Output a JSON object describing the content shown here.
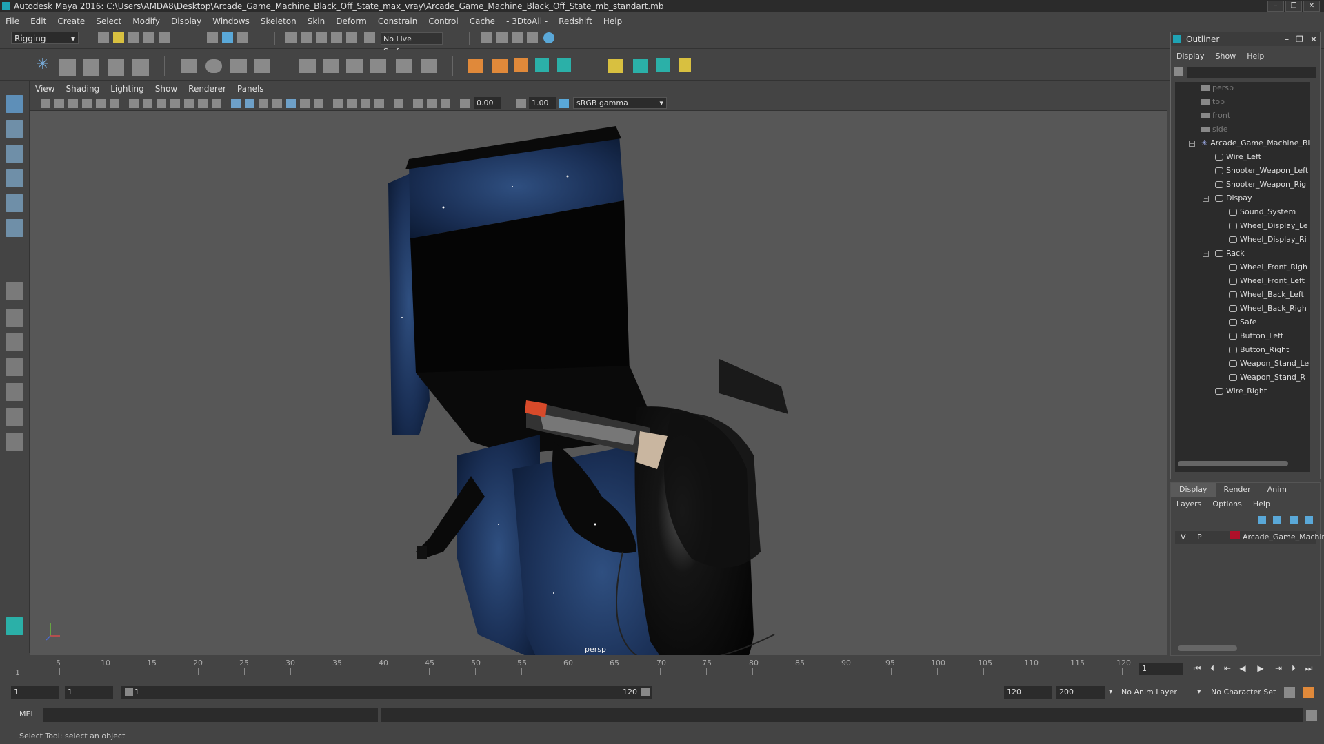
{
  "window": {
    "title": "Autodesk Maya 2016: C:\\Users\\AMDA8\\Desktop\\Arcade_Game_Machine_Black_Off_State_max_vray\\Arcade_Game_Machine_Black_Off_State_mb_standart.mb",
    "buttons": [
      "–",
      "❐",
      "✕"
    ]
  },
  "menu": [
    "File",
    "Edit",
    "Create",
    "Select",
    "Modify",
    "Display",
    "Windows",
    "Skeleton",
    "Skin",
    "Deform",
    "Constrain",
    "Control",
    "Cache",
    "- 3DtoAll -",
    "Redshift",
    "Help"
  ],
  "toolbar": {
    "mode": "Rigging",
    "live_surface": "No Live Surface"
  },
  "viewport": {
    "menu": [
      "View",
      "Shading",
      "Lighting",
      "Show",
      "Renderer",
      "Panels"
    ],
    "exposure": "0.00",
    "gamma_value": "1.00",
    "color_space": "sRGB gamma",
    "camera_label": "persp"
  },
  "outliner": {
    "title": "Outliner",
    "menu": [
      "Display",
      "Show",
      "Help"
    ],
    "items": [
      {
        "label": "persp",
        "type": "camera",
        "indent": 0
      },
      {
        "label": "top",
        "type": "camera",
        "indent": 0
      },
      {
        "label": "front",
        "type": "camera",
        "indent": 0
      },
      {
        "label": "side",
        "type": "camera",
        "indent": 0
      },
      {
        "label": "Arcade_Game_Machine_Bl",
        "type": "root",
        "indent": 0
      },
      {
        "label": "Wire_Left",
        "type": "group",
        "indent": 1
      },
      {
        "label": "Shooter_Weapon_Left",
        "type": "group",
        "indent": 1
      },
      {
        "label": "Shooter_Weapon_Rig",
        "type": "group",
        "indent": 1
      },
      {
        "label": "Dispay",
        "type": "group",
        "indent": 1
      },
      {
        "label": "Sound_System",
        "type": "group",
        "indent": 2
      },
      {
        "label": "Wheel_Display_Le",
        "type": "group",
        "indent": 2
      },
      {
        "label": "Wheel_Display_Ri",
        "type": "group",
        "indent": 2
      },
      {
        "label": "Rack",
        "type": "group",
        "indent": 1
      },
      {
        "label": "Wheel_Front_Righ",
        "type": "group",
        "indent": 2
      },
      {
        "label": "Wheel_Front_Left",
        "type": "group",
        "indent": 2
      },
      {
        "label": "Wheel_Back_Left",
        "type": "group",
        "indent": 2
      },
      {
        "label": "Wheel_Back_Righ",
        "type": "group",
        "indent": 2
      },
      {
        "label": "Safe",
        "type": "group",
        "indent": 2
      },
      {
        "label": "Button_Left",
        "type": "group",
        "indent": 2
      },
      {
        "label": "Button_Right",
        "type": "group",
        "indent": 2
      },
      {
        "label": "Weapon_Stand_Le",
        "type": "group",
        "indent": 2
      },
      {
        "label": "Weapon_Stand_R",
        "type": "group",
        "indent": 2
      },
      {
        "label": "Wire_Right",
        "type": "group",
        "indent": 1
      }
    ]
  },
  "layers": {
    "tabs": [
      "Display",
      "Render",
      "Anim"
    ],
    "menu": [
      "Layers",
      "Options",
      "Help"
    ],
    "layer": {
      "v": "V",
      "p": "P",
      "name": "Arcade_Game_Machin",
      "color": "#b0102a"
    }
  },
  "timeline": {
    "ticks": [
      "1",
      "5",
      "10",
      "15",
      "20",
      "25",
      "30",
      "35",
      "40",
      "45",
      "50",
      "55",
      "60",
      "65",
      "70",
      "75",
      "80",
      "85",
      "90",
      "95",
      "100",
      "105",
      "110",
      "115",
      "120"
    ],
    "current_frame": "1"
  },
  "range": {
    "start": "1",
    "start2": "1",
    "slider_start": "1",
    "slider_end": "120",
    "end": "120",
    "end2": "200",
    "anim_layer": "No Anim Layer",
    "char_set": "No Character Set"
  },
  "mel": {
    "label": "MEL"
  },
  "help": {
    "text": "Select Tool: select an object"
  }
}
